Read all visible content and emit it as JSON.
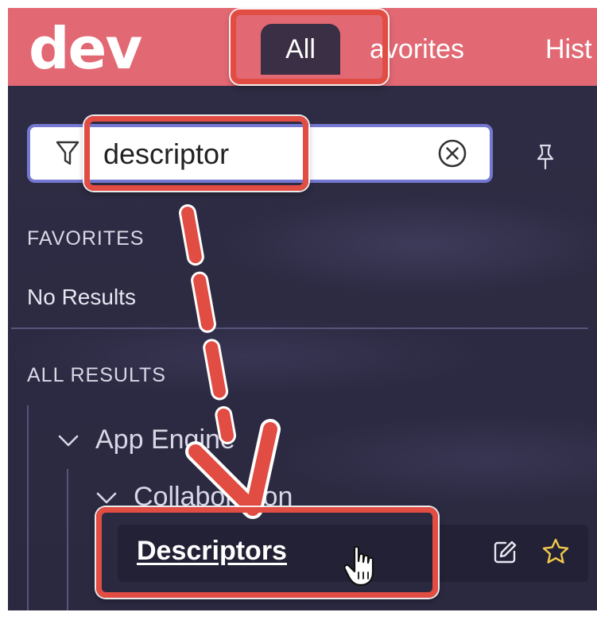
{
  "app": {
    "logo": "dev"
  },
  "nav": {
    "tabs": [
      {
        "label": "All",
        "active": true
      },
      {
        "label": "Favorites",
        "visible_text": "avorites"
      },
      {
        "label": "History",
        "visible_text": "Hist"
      }
    ]
  },
  "filter": {
    "value": "descriptor"
  },
  "favorites": {
    "heading": "FAVORITES",
    "empty_text": "No Results"
  },
  "all_results": {
    "heading": "ALL RESULTS",
    "group": "App Engine",
    "subgroup": "Collaboration",
    "item": "Descriptors"
  },
  "icons": {
    "filter": "filter-funnel-icon",
    "clear": "clear-circle-x-icon",
    "pin": "pin-icon",
    "expand": "chevron-down-icon",
    "edit": "edit-pencil-icon",
    "favorite": "star-outline-icon",
    "cursor": "hand-pointer-cursor-icon"
  },
  "colors": {
    "header": "#e26873",
    "panel": "#2f2d45",
    "active_tab": "#3a2f45",
    "search_border": "#7478d0",
    "annotation": "#e14c43",
    "star": "#f2c94c"
  }
}
